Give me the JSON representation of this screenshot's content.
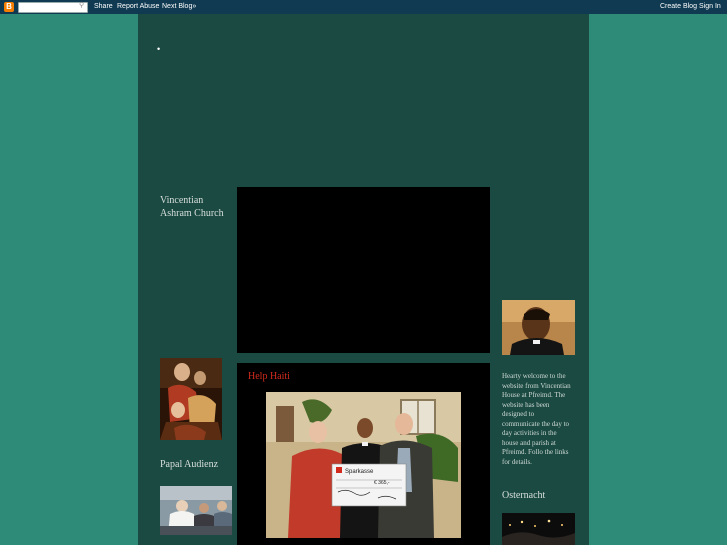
{
  "navbar": {
    "logo": "B",
    "search_placeholder": "",
    "share": "Share",
    "report_abuse": "Report Abuse",
    "next_blog": "Next Blog»",
    "create_blog": "Create Blog",
    "sign_in": "Sign In"
  },
  "header": {
    "bullet": "•"
  },
  "sidebar_left": {
    "church_heading": "Vincentian Ashram Church",
    "papal_heading": "Papal Audienz"
  },
  "main": {
    "post_title": "Help Haiti",
    "cheque": {
      "bank": "Sparkasse",
      "amount": "€ 365,-"
    }
  },
  "sidebar_right": {
    "welcome_text": "Hearty welcome to the website from Vincentian House at Pfreimd. The website has been designed to communicate the day to day activities in the house and parish at Pfreimd. Follo the links for details.",
    "osternacht_heading": "Osternacht"
  },
  "colors": {
    "page_bg": "#2e8b78",
    "content_bg": "#1b4a43",
    "navbar_bg": "#103a52",
    "post_title": "#d32a1e"
  }
}
